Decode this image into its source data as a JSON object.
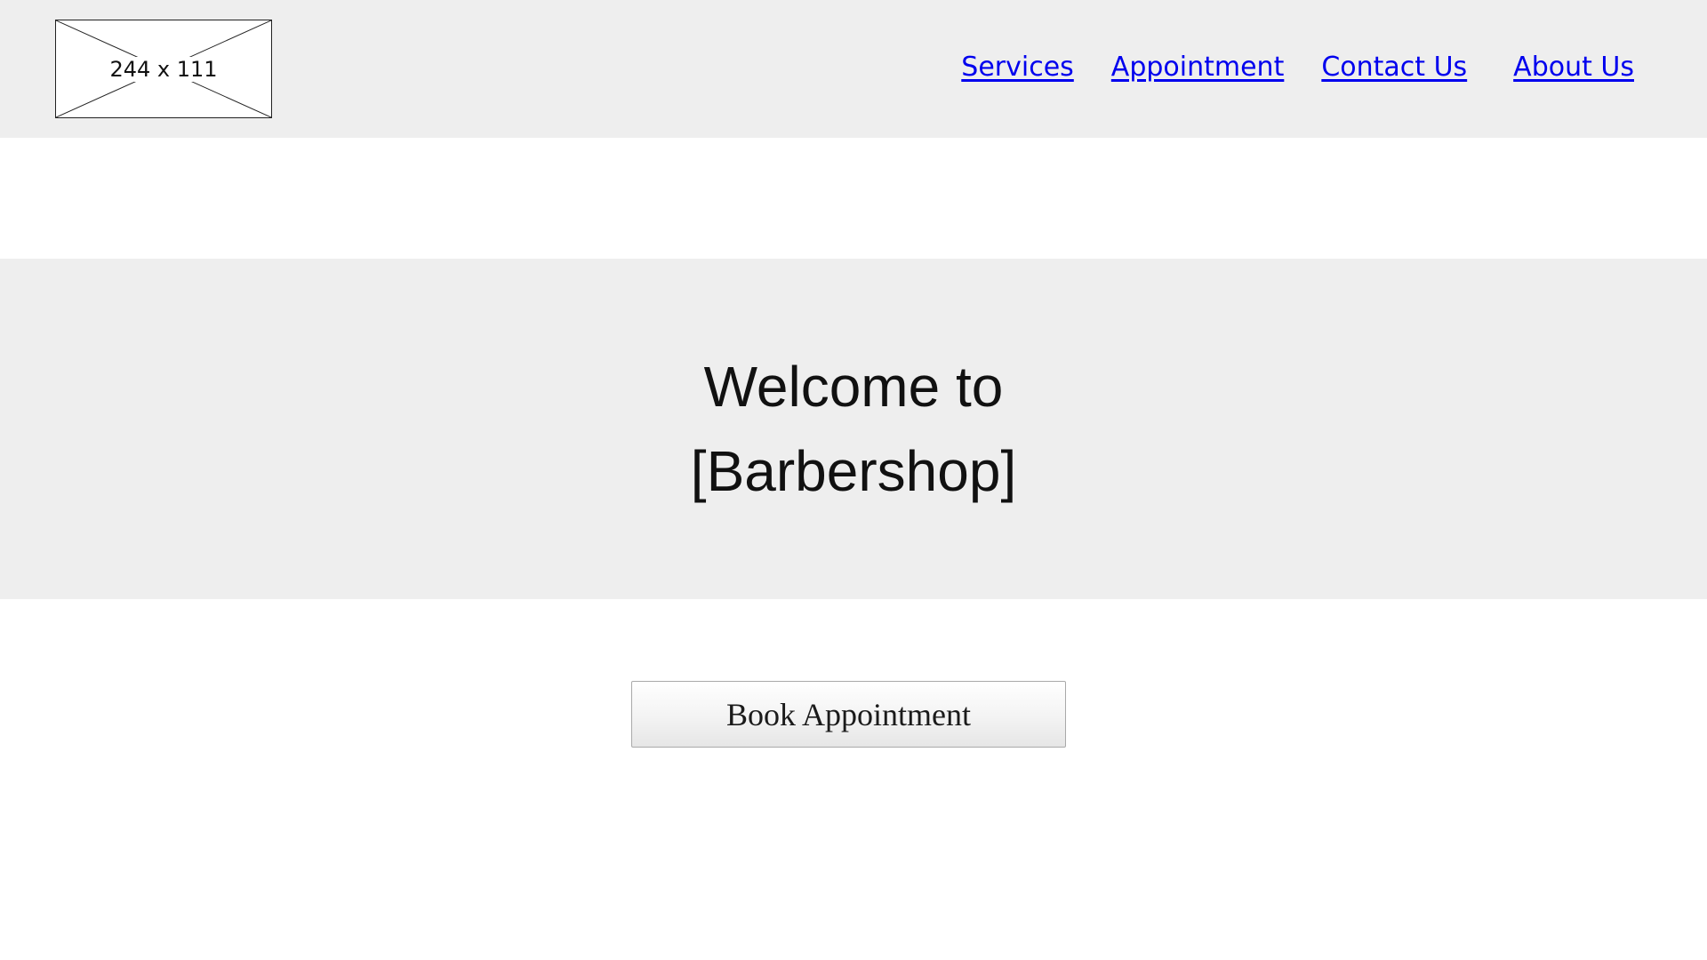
{
  "header": {
    "logo": {
      "placeholder_label": "244 x 111",
      "icon": "image-placeholder-icon"
    },
    "nav": [
      {
        "label": "Services"
      },
      {
        "label": "Appointment"
      },
      {
        "label": "Contact Us"
      },
      {
        "label": "About Us"
      }
    ],
    "link_color": "#0000ee",
    "background": "#eeeeee"
  },
  "hero": {
    "title": "Welcome to [Barbershop]",
    "background": "#eeeeee"
  },
  "cta": {
    "label": "Book Appointment"
  }
}
